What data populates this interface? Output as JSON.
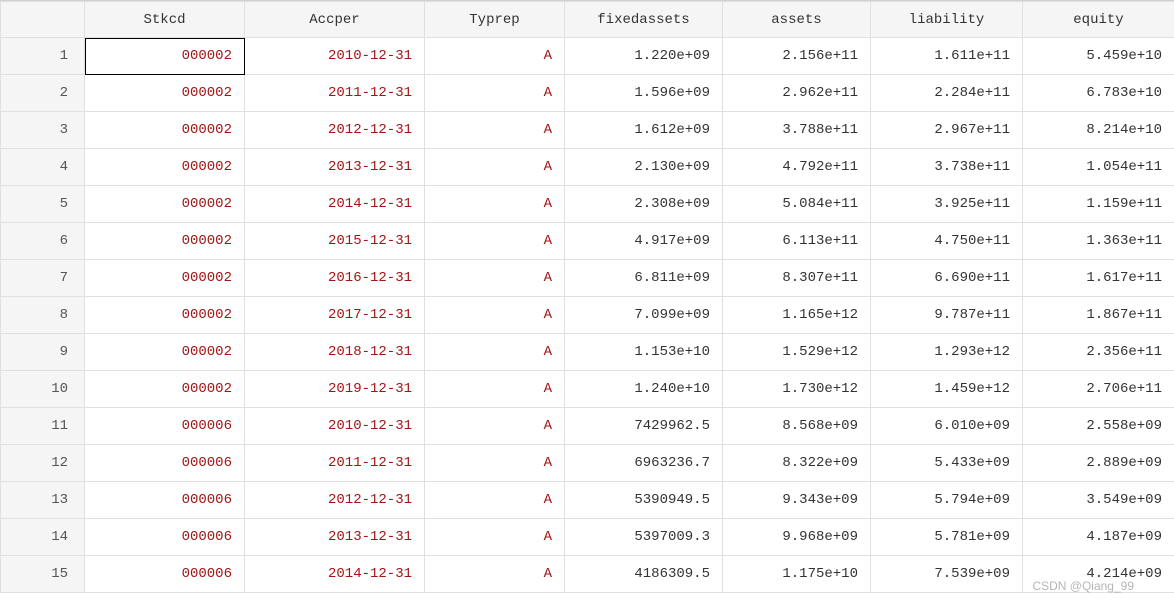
{
  "columns": {
    "stkcd": "Stkcd",
    "accper": "Accper",
    "typrep": "Typrep",
    "fixedassets": "fixedassets",
    "assets": "assets",
    "liability": "liability",
    "equity": "equity"
  },
  "rows": [
    {
      "n": "1",
      "stkcd": "000002",
      "accper": "2010-12-31",
      "typrep": "A",
      "fixedassets": "1.220e+09",
      "assets": "2.156e+11",
      "liability": "1.611e+11",
      "equity": "5.459e+10"
    },
    {
      "n": "2",
      "stkcd": "000002",
      "accper": "2011-12-31",
      "typrep": "A",
      "fixedassets": "1.596e+09",
      "assets": "2.962e+11",
      "liability": "2.284e+11",
      "equity": "6.783e+10"
    },
    {
      "n": "3",
      "stkcd": "000002",
      "accper": "2012-12-31",
      "typrep": "A",
      "fixedassets": "1.612e+09",
      "assets": "3.788e+11",
      "liability": "2.967e+11",
      "equity": "8.214e+10"
    },
    {
      "n": "4",
      "stkcd": "000002",
      "accper": "2013-12-31",
      "typrep": "A",
      "fixedassets": "2.130e+09",
      "assets": "4.792e+11",
      "liability": "3.738e+11",
      "equity": "1.054e+11"
    },
    {
      "n": "5",
      "stkcd": "000002",
      "accper": "2014-12-31",
      "typrep": "A",
      "fixedassets": "2.308e+09",
      "assets": "5.084e+11",
      "liability": "3.925e+11",
      "equity": "1.159e+11"
    },
    {
      "n": "6",
      "stkcd": "000002",
      "accper": "2015-12-31",
      "typrep": "A",
      "fixedassets": "4.917e+09",
      "assets": "6.113e+11",
      "liability": "4.750e+11",
      "equity": "1.363e+11"
    },
    {
      "n": "7",
      "stkcd": "000002",
      "accper": "2016-12-31",
      "typrep": "A",
      "fixedassets": "6.811e+09",
      "assets": "8.307e+11",
      "liability": "6.690e+11",
      "equity": "1.617e+11"
    },
    {
      "n": "8",
      "stkcd": "000002",
      "accper": "2017-12-31",
      "typrep": "A",
      "fixedassets": "7.099e+09",
      "assets": "1.165e+12",
      "liability": "9.787e+11",
      "equity": "1.867e+11"
    },
    {
      "n": "9",
      "stkcd": "000002",
      "accper": "2018-12-31",
      "typrep": "A",
      "fixedassets": "1.153e+10",
      "assets": "1.529e+12",
      "liability": "1.293e+12",
      "equity": "2.356e+11"
    },
    {
      "n": "10",
      "stkcd": "000002",
      "accper": "2019-12-31",
      "typrep": "A",
      "fixedassets": "1.240e+10",
      "assets": "1.730e+12",
      "liability": "1.459e+12",
      "equity": "2.706e+11"
    },
    {
      "n": "11",
      "stkcd": "000006",
      "accper": "2010-12-31",
      "typrep": "A",
      "fixedassets": "7429962.5",
      "assets": "8.568e+09",
      "liability": "6.010e+09",
      "equity": "2.558e+09"
    },
    {
      "n": "12",
      "stkcd": "000006",
      "accper": "2011-12-31",
      "typrep": "A",
      "fixedassets": "6963236.7",
      "assets": "8.322e+09",
      "liability": "5.433e+09",
      "equity": "2.889e+09"
    },
    {
      "n": "13",
      "stkcd": "000006",
      "accper": "2012-12-31",
      "typrep": "A",
      "fixedassets": "5390949.5",
      "assets": "9.343e+09",
      "liability": "5.794e+09",
      "equity": "3.549e+09"
    },
    {
      "n": "14",
      "stkcd": "000006",
      "accper": "2013-12-31",
      "typrep": "A",
      "fixedassets": "5397009.3",
      "assets": "9.968e+09",
      "liability": "5.781e+09",
      "equity": "4.187e+09"
    },
    {
      "n": "15",
      "stkcd": "000006",
      "accper": "2014-12-31",
      "typrep": "A",
      "fixedassets": "4186309.5",
      "assets": "1.175e+10",
      "liability": "7.539e+09",
      "equity": "4.214e+09"
    }
  ],
  "watermark": "CSDN @Qiang_99"
}
